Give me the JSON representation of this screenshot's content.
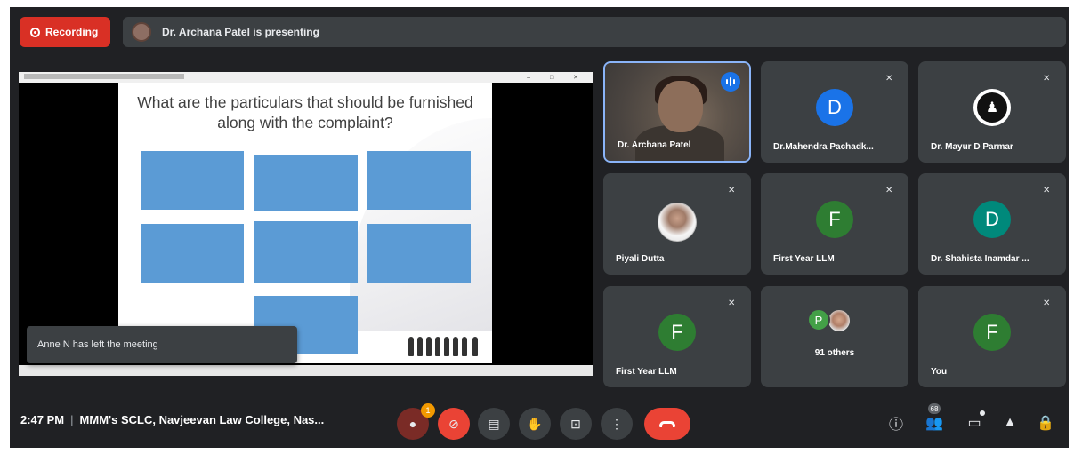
{
  "top_bar": {
    "recording_label": "Recording",
    "presenting_text": "Dr. Archana Patel is presenting"
  },
  "shared_screen": {
    "slide_title": "What are the particulars that should be furnished along with the complaint?",
    "boxes": [
      "",
      "",
      "",
      "",
      "",
      "",
      ""
    ],
    "toast": "Anne N has left the meeting"
  },
  "tiles": [
    {
      "name": "Dr. Archana Patel",
      "type": "video",
      "speaking": true
    },
    {
      "name": "Dr.Mahendra Pachadk...",
      "letter": "D",
      "color": "#1a73e8",
      "muted": true
    },
    {
      "name": "Dr. Mayur D Parmar",
      "type": "avatar",
      "muted": true
    },
    {
      "name": "Piyali Dutta",
      "type": "photo",
      "muted": true
    },
    {
      "name": "First Year LLM",
      "letter": "F",
      "color": "#2e7d32",
      "muted": true
    },
    {
      "name": "Dr. Shahista Inamdar ...",
      "letter": "D",
      "color": "#00897b",
      "muted": true
    },
    {
      "name": "First Year LLM",
      "letter": "F",
      "color": "#2e7d32",
      "muted": true
    },
    {
      "name": "91 others",
      "others_letter": "P",
      "type": "others"
    },
    {
      "name": "You",
      "letter": "F",
      "color": "#2e7d32",
      "muted": true
    }
  ],
  "bottom_bar": {
    "time": "2:47 PM",
    "meeting_name": "MMM's SCLC, Navjeevan Law College, Nas...",
    "mic_badge": "1",
    "people_count": "68"
  },
  "colors": {
    "background": "#202124",
    "tile": "#3c4043",
    "recording": "#d93025",
    "accent": "#1a73e8",
    "slide_box": "#5b9bd5"
  }
}
